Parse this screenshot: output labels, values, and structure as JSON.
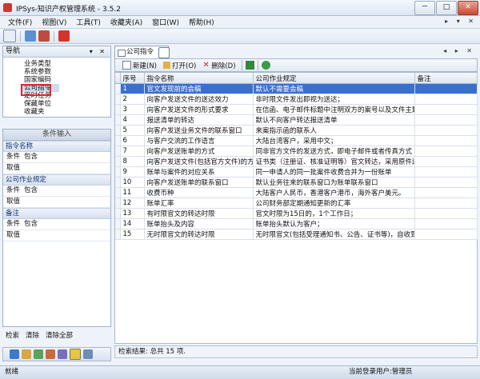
{
  "window": {
    "title": "IPSys-知识产权管理系统 - 3.5.2",
    "controls": [
      "－",
      "□",
      "✕"
    ]
  },
  "menu": [
    "文件(F)",
    "视图(V)",
    "工具(T)",
    "收藏夹(A)",
    "窗口(W)",
    "帮助(H)"
  ],
  "menu_right": "▸ ▾ ✕",
  "nav": {
    "title": "导航",
    "pin": "▾ ✕",
    "items": [
      "业务类型",
      "系统参数",
      "国家编码",
      "公司指令",
      "定时任务",
      "保藏单位",
      "收藏夹"
    ],
    "selected_index": 3
  },
  "conditions": {
    "title": "条件输入",
    "groups": [
      {
        "name": "指令名称",
        "op_label": "条件",
        "op_value": "包含",
        "value_label": "取值",
        "value": ""
      },
      {
        "name": "公司作业规定",
        "op_label": "条件",
        "op_value": "包含",
        "value_label": "取值",
        "value": ""
      },
      {
        "name": "备注",
        "op_label": "条件",
        "op_value": "包含",
        "value_label": "取值",
        "value": ""
      }
    ]
  },
  "search_bar": {
    "search": "检索",
    "clear": "清除",
    "clear_all": "清除全部"
  },
  "main": {
    "tab_label": "公司指令",
    "right_icons": "◂ ▸ ✕",
    "toolbar": {
      "new": "新建(N)",
      "open": "打开(O)",
      "delete": "删除(D)"
    },
    "columns": [
      "序号",
      "指令名称",
      "公司作业规定",
      "备注"
    ],
    "rows": [
      {
        "no": "1",
        "name": "官文发现前的会稿",
        "rule": "默认不需要会稿",
        "note": ""
      },
      {
        "no": "2",
        "name": "向客户发送文件的送达效力",
        "rule": "非时限文件发出即视为送达；",
        "note": ""
      },
      {
        "no": "3",
        "name": "向客户发送文件的形式要求",
        "rule": "在信函、电子邮件标题中注明双方的案号以及文件主题；",
        "note": ""
      },
      {
        "no": "4",
        "name": "报送清单的转达",
        "rule": "默认不向客户转达报送清单",
        "note": ""
      },
      {
        "no": "5",
        "name": "向客户发送业务文件的联系窗口",
        "rule": "来案指示函的联系人",
        "note": ""
      },
      {
        "no": "6",
        "name": "与客户交流的工作语言",
        "rule": "大陆台湾客户，采用中文；",
        "note": ""
      },
      {
        "no": "7",
        "name": "向客户发送账单的方式",
        "rule": "同非官方文件的发送方式，即电子邮件或者传真方式",
        "note": ""
      },
      {
        "no": "8",
        "name": "向客户发送文件(包括官方文件)的方式",
        "rule": "证书类（注册证、核准证明等）官文转达，采用原件送达，大陆、",
        "note": ""
      },
      {
        "no": "9",
        "name": "账单与案件的对应关系",
        "rule": "同一申请人的同一批案件收费合并为一份账单",
        "note": ""
      },
      {
        "no": "10",
        "name": "向客户发送账单的联系窗口",
        "rule": "默认业务往来的联系窗口为账单联系窗口",
        "note": ""
      },
      {
        "no": "11",
        "name": "收费币种",
        "rule": "大陆客户人民币，香港客户港币，海外客户美元。",
        "note": ""
      },
      {
        "no": "12",
        "name": "账单汇率",
        "rule": "公司财务部定期通知更新的汇率",
        "note": ""
      },
      {
        "no": "13",
        "name": "有时限官文的转达时限",
        "rule": "官文时限为15日的，1个工作日；",
        "note": ""
      },
      {
        "no": "14",
        "name": "账单抬头及内容",
        "rule": "账单抬头默认为客户；",
        "note": ""
      },
      {
        "no": "15",
        "name": "无时限官文的转达时限",
        "rule": "无时限官文(包括受理通知书、公告、证书等)，自收到日起2周内。",
        "note": ""
      }
    ],
    "result_text": "检索结果: 总共 15 项."
  },
  "statusbar": {
    "left": "就绪",
    "right": "当前登录用户:管理员"
  }
}
